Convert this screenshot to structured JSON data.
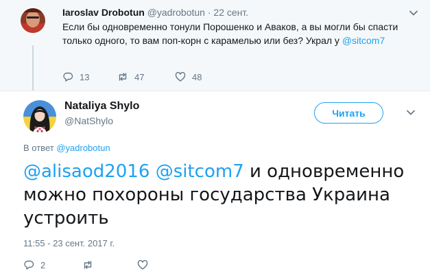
{
  "parent_tweet": {
    "author_name": "Iaroslav Drobotun",
    "author_handle": "@yadrobotun",
    "separator": "·",
    "date": "22 сент.",
    "text": "Если бы одновременно тонули Порошенко и Аваков, а вы могли бы спасти только одного, то вам поп-корн с карамелью или без? Украл у ",
    "text_mention": "@sitcom7",
    "replies": "13",
    "retweets": "47",
    "likes": "48"
  },
  "main_tweet": {
    "author_name": "Nataliya Shylo",
    "author_handle": "@NatShylo",
    "follow_label": "Читать",
    "reply_prefix": "В ответ",
    "reply_mention": "@yadrobotun",
    "mention_1": "@alisaod2016",
    "mention_2": "@sitcom7",
    "text": "и одновременно можно похороны государства Украина устроить",
    "timestamp": "11:55 - 23 сент. 2017 г.",
    "replies": "2"
  },
  "colors": {
    "accent": "#1da1f2",
    "muted": "#657786",
    "text": "#14171a",
    "parent_bg": "#f5f8fa"
  },
  "icons": [
    "reply-icon",
    "retweet-icon",
    "like-icon",
    "chevron-down-icon"
  ]
}
